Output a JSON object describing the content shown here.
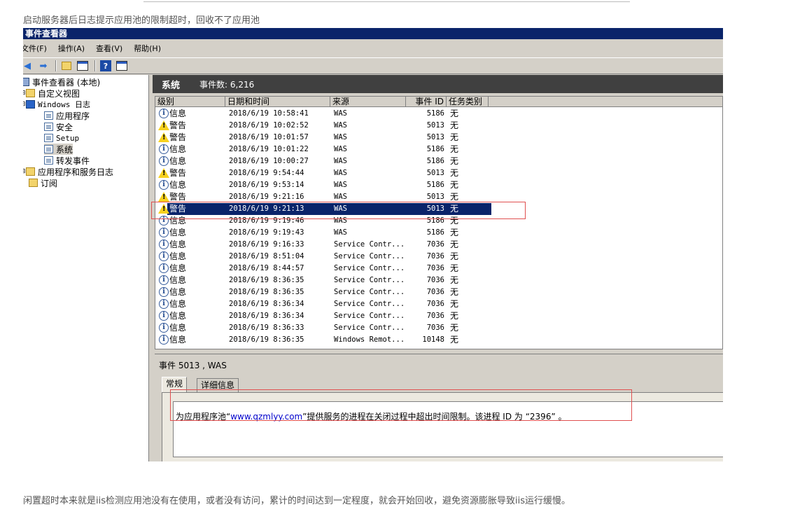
{
  "captions": {
    "top": "启动服务器后日志提示应用池的限制超时，回收不了应用池",
    "bottom": "闲置超时本来就是iis检测应用池没有在使用，或者没有访问，累计的时间达到一定程度，就会开始回收，避免资源膨胀导致iis运行缓慢。"
  },
  "window": {
    "title": "事件查看器"
  },
  "menu": [
    {
      "label": "文件(F)"
    },
    {
      "label": "操作(A)"
    },
    {
      "label": "查看(V)"
    },
    {
      "label": "帮助(H)"
    }
  ],
  "toolbar": {
    "help_glyph": "?"
  },
  "tree": [
    {
      "label": "事件查看器 (本地)",
      "icon": "viewer-icon"
    },
    {
      "label": "自定义视图",
      "icon": "folder-icon"
    },
    {
      "label": "Windows 日志",
      "icon": "windows-log-icon"
    },
    {
      "label": "应用程序",
      "icon": "log-icon"
    },
    {
      "label": "安全",
      "icon": "log-icon"
    },
    {
      "label": "Setup",
      "icon": "log-icon"
    },
    {
      "label": "系统",
      "icon": "log-icon"
    },
    {
      "label": "转发事件",
      "icon": "log-icon"
    },
    {
      "label": "应用程序和服务日志",
      "icon": "folder-icon"
    },
    {
      "label": "订阅",
      "icon": "subscription-icon"
    }
  ],
  "panel": {
    "title": "系统",
    "count_label": "事件数: 6,216"
  },
  "columns": [
    "级别",
    "日期和时间",
    "来源",
    "事件 ID",
    "任务类别"
  ],
  "events": [
    {
      "level": "信息",
      "icon": "info-icon",
      "date": "2018/6/19 10:58:41",
      "source": "WAS",
      "id": "5186",
      "task": "无"
    },
    {
      "level": "警告",
      "icon": "warning-icon",
      "date": "2018/6/19 10:02:52",
      "source": "WAS",
      "id": "5013",
      "task": "无"
    },
    {
      "level": "警告",
      "icon": "warning-icon",
      "date": "2018/6/19 10:01:57",
      "source": "WAS",
      "id": "5013",
      "task": "无"
    },
    {
      "level": "信息",
      "icon": "info-icon",
      "date": "2018/6/19 10:01:22",
      "source": "WAS",
      "id": "5186",
      "task": "无"
    },
    {
      "level": "信息",
      "icon": "info-icon",
      "date": "2018/6/19 10:00:27",
      "source": "WAS",
      "id": "5186",
      "task": "无"
    },
    {
      "level": "警告",
      "icon": "warning-icon",
      "date": "2018/6/19 9:54:44",
      "source": "WAS",
      "id": "5013",
      "task": "无"
    },
    {
      "level": "信息",
      "icon": "info-icon",
      "date": "2018/6/19 9:53:14",
      "source": "WAS",
      "id": "5186",
      "task": "无"
    },
    {
      "level": "警告",
      "icon": "warning-icon",
      "date": "2018/6/19 9:21:16",
      "source": "WAS",
      "id": "5013",
      "task": "无"
    },
    {
      "level": "警告",
      "icon": "warning-icon",
      "date": "2018/6/19 9:21:13",
      "source": "WAS",
      "id": "5013",
      "task": "无",
      "selected": true
    },
    {
      "level": "信息",
      "icon": "info-icon",
      "date": "2018/6/19 9:19:46",
      "source": "WAS",
      "id": "5186",
      "task": "无"
    },
    {
      "level": "信息",
      "icon": "info-icon",
      "date": "2018/6/19 9:19:43",
      "source": "WAS",
      "id": "5186",
      "task": "无"
    },
    {
      "level": "信息",
      "icon": "info-icon",
      "date": "2018/6/19 9:16:33",
      "source": "Service Contr...",
      "id": "7036",
      "task": "无"
    },
    {
      "level": "信息",
      "icon": "info-icon",
      "date": "2018/6/19 8:51:04",
      "source": "Service Contr...",
      "id": "7036",
      "task": "无"
    },
    {
      "level": "信息",
      "icon": "info-icon",
      "date": "2018/6/19 8:44:57",
      "source": "Service Contr...",
      "id": "7036",
      "task": "无"
    },
    {
      "level": "信息",
      "icon": "info-icon",
      "date": "2018/6/19 8:36:35",
      "source": "Service Contr...",
      "id": "7036",
      "task": "无"
    },
    {
      "level": "信息",
      "icon": "info-icon",
      "date": "2018/6/19 8:36:35",
      "source": "Service Contr...",
      "id": "7036",
      "task": "无"
    },
    {
      "level": "信息",
      "icon": "info-icon",
      "date": "2018/6/19 8:36:34",
      "source": "Service Contr...",
      "id": "7036",
      "task": "无"
    },
    {
      "level": "信息",
      "icon": "info-icon",
      "date": "2018/6/19 8:36:34",
      "source": "Service Contr...",
      "id": "7036",
      "task": "无"
    },
    {
      "level": "信息",
      "icon": "info-icon",
      "date": "2018/6/19 8:36:33",
      "source": "Service Contr...",
      "id": "7036",
      "task": "无"
    },
    {
      "level": "信息",
      "icon": "info-icon",
      "date": "2018/6/19 8:36:35",
      "source": "Windows Remot...",
      "id": "10148",
      "task": "无"
    }
  ],
  "detail": {
    "title": "事件 5013 , WAS",
    "tabs": [
      "常规",
      "详细信息"
    ],
    "message_prefix": "为应用程序池“",
    "message_link": "www.qzmlyy.com",
    "message_suffix": "”提供服务的进程在关闭过程中超出时间限制。该进程 ID 为 “2396” 。"
  },
  "colors": {
    "titlebar": "#0a246a",
    "selection": "#0a246a",
    "panel_header": "#404040",
    "highlight_box": "#e05050"
  }
}
